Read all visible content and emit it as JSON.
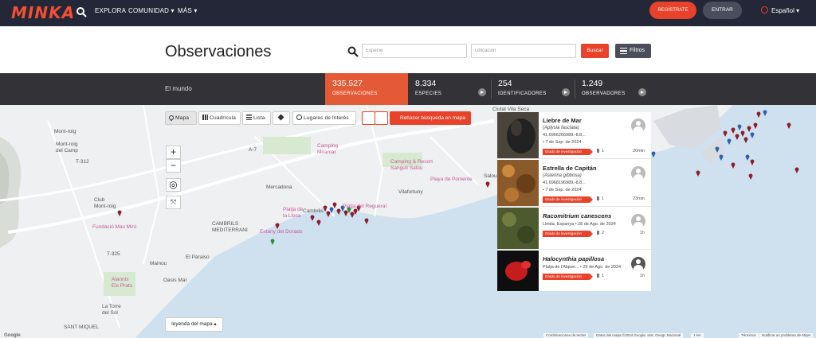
{
  "nav": {
    "logo": "MINKA",
    "explora": "EXPLORA",
    "comunidad": "COMUNIDAD ▾",
    "mas": "MÁS ▾",
    "register": "REGÍSTRATE",
    "enter": "ENTRAR",
    "language": "Español ▾"
  },
  "header": {
    "title": "Observaciones",
    "species_placeholder": "Especie",
    "location_placeholder": "Ubicación",
    "search_button": "Buscar",
    "filters_button": "Filtros"
  },
  "stats": {
    "region": "El mundo",
    "items": [
      {
        "value": "335.527",
        "label": "OBSERVACIONES"
      },
      {
        "value": "8.334",
        "label": "ESPECIES"
      },
      {
        "value": "254",
        "label": "IDENTIFICADORES"
      },
      {
        "value": "1.249",
        "label": "OBSERVADORES"
      }
    ]
  },
  "map_toolbar": {
    "mapa": "Mapa",
    "cuadricula": "Cuadrícula",
    "lista": "Lista",
    "lugares": "Lugares de Interés",
    "rehacer": "Rehacer búsqueda en mapa",
    "legend": "leyenda del mapa ▴"
  },
  "map_labels": {
    "montroig_camp": "Mont-roig\ndel Camp",
    "club_montroig": "Club\nMont-roig",
    "fundacio": "Fundació Mas Miró",
    "camping_miramar": "Camping\nMiramar",
    "camping_resort": "Camping & Resort\nSangulí Salou",
    "mercadona": "Mercadona",
    "playa_poniente": "Playa de Poniente",
    "vilafortuny": "Vilafortuny",
    "cambrils": "Cambrils",
    "platja_regueral": "Platja del Regueral",
    "les_dunes": "Les Dunes",
    "cambrils_mediterrani": "CAMBRILS\nMEDITERRANI",
    "platja_llosa": "Platja de\nla Llosa",
    "estany": "Estany del Dorado",
    "el_paraiso": "El Paraiso",
    "mainou": "Mainou",
    "oasis_mar": "Oasis Mar",
    "alannis": "Alannis\nEls Prats",
    "torre_sol": "La Torre\ndel Sol",
    "sant_miquel": "SANT MIQUEL",
    "salou": "Salou",
    "ciutat": "Ciutat Vila Seca",
    "m1": "Mont-roig",
    "m2": "A-7",
    "m3": "T-312",
    "m4": "T-325"
  },
  "observations": [
    {
      "name": "Liebre de Mar",
      "sci": "(Aplysia fasciata)",
      "loc": "41.6966266989,-8.8...",
      "date": "• 7 de Sep. de 2024",
      "grade": "Grado de investigación",
      "ids": "1",
      "time": "20min"
    },
    {
      "name": "Estrella de Capitán",
      "sci": "(Asterina gibbosa)",
      "loc": "41.6968196989,-8.8...",
      "date": "• 7 de Sep. de 2024",
      "grade": "Grado de investigación",
      "ids": "1",
      "time": "23min"
    },
    {
      "name": "Racomitrium canescens",
      "sci": "",
      "loc": "Lleida, Espanya • 28 de Ago. de 2024",
      "date": "",
      "grade": "Grado de investigación",
      "ids": "2",
      "time": "1h"
    },
    {
      "name": "Halocynthia papillosa",
      "sci": "",
      "loc": "Platja de l'Alquer... • 29 de Ago. de 2024",
      "date": "",
      "grade": "Grado de investigación",
      "ids": "1",
      "time": "1h"
    }
  ],
  "attribution": {
    "google": "Google",
    "shortcuts": "Combinaciones de teclas",
    "mapdata": "Datos del mapa ©2024 Google, Inst. Geogr. Nacional",
    "scale": "1 km",
    "terms": "Términos",
    "report": "Notificar un problema de Maps"
  },
  "colors": {
    "nav_bg": "#242737",
    "accent": "#e8422a",
    "stats_bg": "#333337",
    "active_stat": "#e55a36"
  }
}
